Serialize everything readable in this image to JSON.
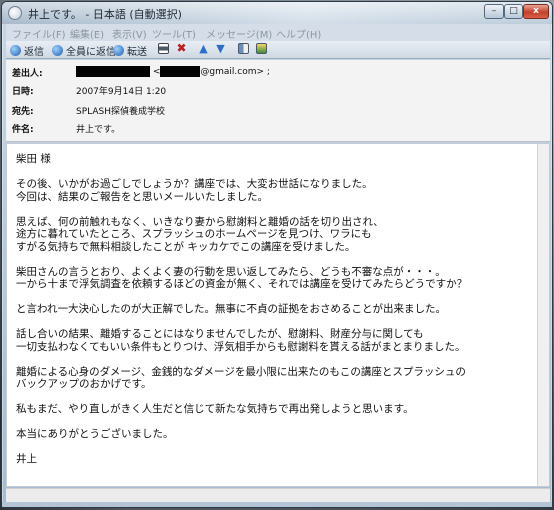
{
  "window": {
    "title": "井上です。 - 日本語 (自動選択)",
    "min_symbol": "–",
    "max_symbol": "□",
    "close_symbol": "x"
  },
  "menu": [
    "ファイル(F)",
    "編集(E)",
    "表示(V)",
    "ツール(T)",
    "メッセージ(M)",
    "ヘルプ(H)"
  ],
  "toolbar": {
    "reply": "返信",
    "reply_all": "全員に返信",
    "forward": "転送",
    "prev_symbol": "▲",
    "next_symbol": "▼",
    "delete_symbol": "✖",
    "icons": [
      "reply-icon",
      "reply-all-icon",
      "forward-icon",
      "print-icon",
      "delete-icon",
      "previous-icon",
      "next-icon",
      "address-book-icon",
      "contact-icon"
    ]
  },
  "header": {
    "from_label": "差出人:",
    "from_lt": "<",
    "from_domain": "@gmail.com> ;",
    "date_label": "日時:",
    "date_value": "2007年9月14日 1:20",
    "to_label": "宛先:",
    "to_value": "SPLASH探偵養成学校",
    "subject_label": "件名:",
    "subject_value": "井上です。"
  },
  "body": [
    "柴田 様",
    "",
    "その後、いかがお過ごしでしょうか？講座では、大変お世話になりました。",
    "今回は、結果のご報告をと思いメールいたしました。",
    "",
    "思えば、何の前触れもなく、いきなり妻から慰謝料と離婚の話を切り出され、",
    "途方に暮れていたところ、スプラッシュのホームページを見つけ、ワラにも",
    "すがる気持ちで無料相談したことが キッカケでこの講座を受けました。",
    "",
    "柴田さんの言うとおり、よくよく妻の行動を思い返してみたら、どうも不審な点が・・・。",
    "一から十まで浮気調査を依頼するほどの資金が無く、それでは講座を受けてみたらどうですか？",
    "",
    "と言われ一大決心したのが大正解でした。無事に不貞の証拠をおさめることが出来ました。",
    "",
    "話し合いの結果、離婚することにはなりませんでしたが、慰謝料、財産分与に関しても",
    "一切支払わなくてもいい条件もとりつけ、浮気相手からも慰謝料を貰える話がまとまりました。",
    "",
    "離婚による心身のダメージ、金銭的なダメージを最小限に出来たのもこの講座とスプラッシュの",
    "バックアップのおかげです。",
    "",
    "私もまだ、やり直しがきく人生だと信じて新たな気持ちで再出発しようと思います。",
    "",
    "本当にありがとうございました。",
    "",
    "井上"
  ]
}
